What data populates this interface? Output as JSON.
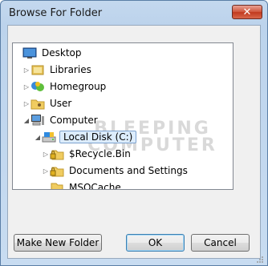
{
  "window": {
    "title": "Browse For Folder",
    "close_glyph": "✕"
  },
  "watermark": {
    "line1": "BLEEPING",
    "line2": "COMPUTER"
  },
  "tree": {
    "scrollbar": {
      "up_glyph": "▲",
      "down_glyph": "▼"
    },
    "items": [
      {
        "label": "Desktop",
        "icon": "desktop-icon",
        "expander": ""
      },
      {
        "label": "Libraries",
        "icon": "libraries-icon",
        "expander": "▷"
      },
      {
        "label": "Homegroup",
        "icon": "homegroup-icon",
        "expander": "▷"
      },
      {
        "label": "User",
        "icon": "user-folder-icon",
        "expander": "▷"
      },
      {
        "label": "Computer",
        "icon": "computer-icon",
        "expander": "◢"
      },
      {
        "label": "Local Disk (C:)",
        "icon": "local-disk-icon",
        "expander": "◢",
        "selected": true
      },
      {
        "label": "$Recycle.Bin",
        "icon": "locked-folder-icon",
        "expander": "▷"
      },
      {
        "label": "Documents and Settings",
        "icon": "locked-folder-icon",
        "expander": "▷"
      },
      {
        "label": "MSOCache",
        "icon": "folder-icon",
        "expander": ""
      }
    ]
  },
  "buttons": {
    "make_new_folder": "Make New Folder",
    "ok": "OK",
    "cancel": "Cancel"
  },
  "colors": {
    "titlebar": "#bcd3ec",
    "selection": "#dcecfc",
    "close": "#c13a1f"
  }
}
